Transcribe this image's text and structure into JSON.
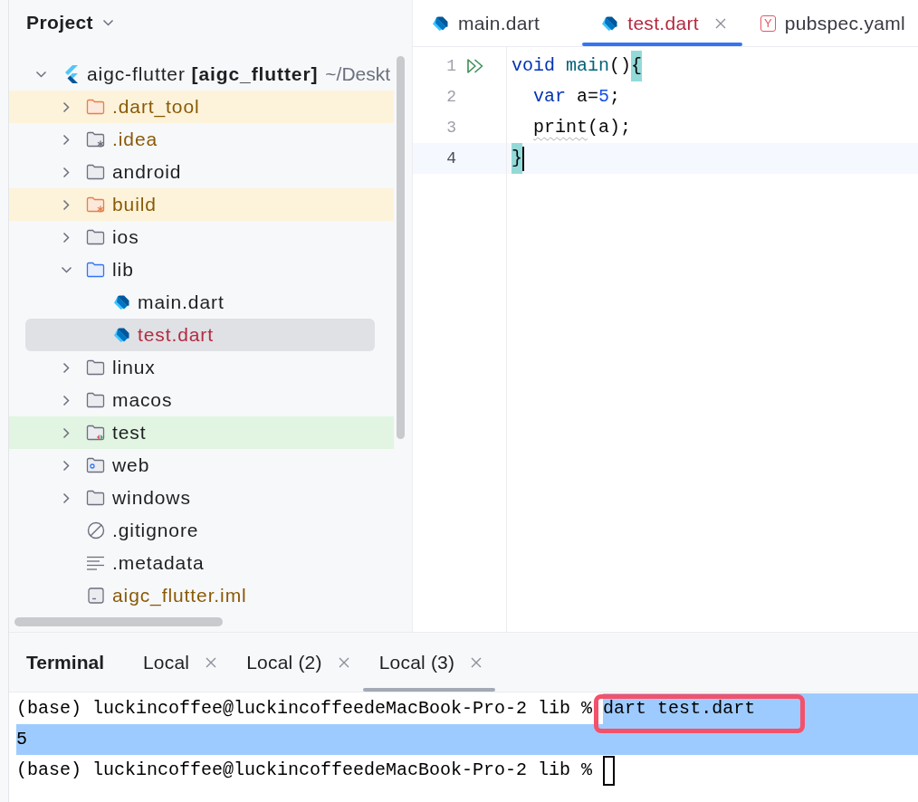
{
  "project_panel": {
    "title": "Project",
    "tree": [
      {
        "label": "aigc-flutter **[aigc_flutter]**",
        "path": "~/Deskt",
        "kind": "project",
        "color": "#1e1f22",
        "expanded": true,
        "selected": false,
        "children": [
          {
            "label": ".dart_tool",
            "kind": "excluded-folder",
            "color": "#8a5a06",
            "expanded": false,
            "selected": false
          },
          {
            "label": ".idea",
            "kind": "config-folder",
            "color": "#8a5a06",
            "expanded": false,
            "selected": false
          },
          {
            "label": "android",
            "kind": "folder",
            "color": "#1e1f22",
            "expanded": false,
            "selected": false
          },
          {
            "label": "build",
            "kind": "generated-folder",
            "color": "#8a5a06",
            "expanded": false,
            "selected": false
          },
          {
            "label": "ios",
            "kind": "folder",
            "color": "#1e1f22",
            "expanded": false,
            "selected": false
          },
          {
            "label": "lib",
            "kind": "source-folder",
            "color": "#1e1f22",
            "expanded": true,
            "selected": false,
            "children": [
              {
                "label": "main.dart",
                "kind": "dart-file",
                "color": "#1e1f22",
                "selected": false
              },
              {
                "label": "test.dart",
                "kind": "dart-file",
                "color": "#b42a3f",
                "selected": true
              }
            ]
          },
          {
            "label": "linux",
            "kind": "folder",
            "color": "#1e1f22",
            "expanded": false,
            "selected": false
          },
          {
            "label": "macos",
            "kind": "folder",
            "color": "#1e1f22",
            "expanded": false,
            "selected": false
          },
          {
            "label": "test",
            "kind": "test-folder",
            "color": "#1e1f22",
            "expanded": false,
            "selected": false
          },
          {
            "label": "web",
            "kind": "web-folder",
            "color": "#1e1f22",
            "expanded": false,
            "selected": false
          },
          {
            "label": "windows",
            "kind": "folder",
            "color": "#1e1f22",
            "expanded": false,
            "selected": false
          },
          {
            "label": ".gitignore",
            "kind": "ignore-file",
            "color": "#1e1f22",
            "selected": false
          },
          {
            "label": ".metadata",
            "kind": "text-file",
            "color": "#1e1f22",
            "selected": false
          },
          {
            "label": "aigc_flutter.iml",
            "kind": "module-file",
            "color": "#8a5a06",
            "selected": false
          }
        ]
      }
    ]
  },
  "editor": {
    "tabs": [
      {
        "label": "main.dart",
        "kind": "dart",
        "color": "#383a42",
        "selected": false
      },
      {
        "label": "test.dart",
        "kind": "dart",
        "color": "#b42a3f",
        "selected": true
      },
      {
        "label": "pubspec.yaml",
        "kind": "yaml",
        "badge": "Y",
        "color": "#383a42",
        "selected": false
      }
    ],
    "lines": [
      {
        "number": "1",
        "run_marker": true,
        "current": false,
        "tokens": [
          {
            "text": "void",
            "kind": "keyword"
          },
          {
            "text": " main",
            "kind": "function"
          },
          {
            "text": "()",
            "kind": "plain"
          },
          {
            "text": "{",
            "kind": "matched-brace"
          }
        ]
      },
      {
        "number": "2",
        "run_marker": false,
        "current": false,
        "tokens": [
          {
            "text": "  var",
            "kind": "keyword"
          },
          {
            "text": " a=",
            "kind": "plain"
          },
          {
            "text": "5",
            "kind": "number"
          },
          {
            "text": ";",
            "kind": "plain"
          }
        ]
      },
      {
        "number": "3",
        "run_marker": false,
        "current": false,
        "tokens": [
          {
            "text": "  print",
            "kind": "warning"
          },
          {
            "text": "(a);",
            "kind": "plain"
          }
        ]
      },
      {
        "number": "4",
        "run_marker": false,
        "current": true,
        "tokens": [
          {
            "text": "}",
            "kind": "matched-brace"
          }
        ]
      }
    ]
  },
  "terminal": {
    "title": "Terminal",
    "tabs": [
      {
        "label": "Local",
        "selected": false
      },
      {
        "label": "Local (2)",
        "selected": false
      },
      {
        "label": "Local (3)",
        "selected": true
      }
    ],
    "lines": [
      {
        "cursor": false,
        "segments": [
          {
            "text": "(base) luckincoffee@luckincoffeedeMacBook-Pro-2 lib % ",
            "selected": false,
            "framed": false
          },
          {
            "text": "dart test.dart",
            "selected": true,
            "framed": true
          }
        ]
      },
      {
        "cursor": false,
        "segments": [
          {
            "text": "5",
            "selected": true,
            "framed": false
          }
        ]
      },
      {
        "cursor": true,
        "segments": [
          {
            "text": "(base) luckincoffee@luckincoffeedeMacBook-Pro-2 lib % ",
            "selected": false,
            "framed": false
          }
        ]
      }
    ]
  }
}
